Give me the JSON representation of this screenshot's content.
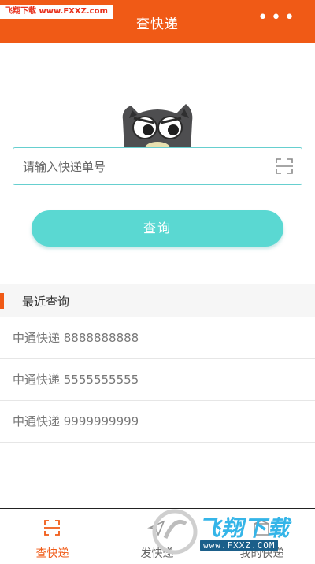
{
  "header": {
    "title": "查快递",
    "more_label": "•••"
  },
  "watermark": {
    "top_text": "飞翔下载 www.FXXZ.com",
    "bottom_big": "飞翔下载",
    "bottom_small": "www.FXXZ.COM"
  },
  "search": {
    "placeholder": "请输入快递单号",
    "value": ""
  },
  "query_button": {
    "label": "查询"
  },
  "recent": {
    "label": "最近查询",
    "items": [
      {
        "text": "中通快递 8888888888"
      },
      {
        "text": "中通快递 5555555555"
      },
      {
        "text": "中通快递 9999999999"
      }
    ]
  },
  "tabbar": {
    "tabs": [
      {
        "label": "查快递",
        "icon": "scan-icon",
        "active": true
      },
      {
        "label": "发快递",
        "icon": "send-icon",
        "active": false
      },
      {
        "label": "我的快递",
        "icon": "box-icon",
        "active": false
      }
    ]
  },
  "colors": {
    "brand": "#f05a16",
    "accent": "#5ad8d2",
    "input_border": "#66cfcf"
  }
}
